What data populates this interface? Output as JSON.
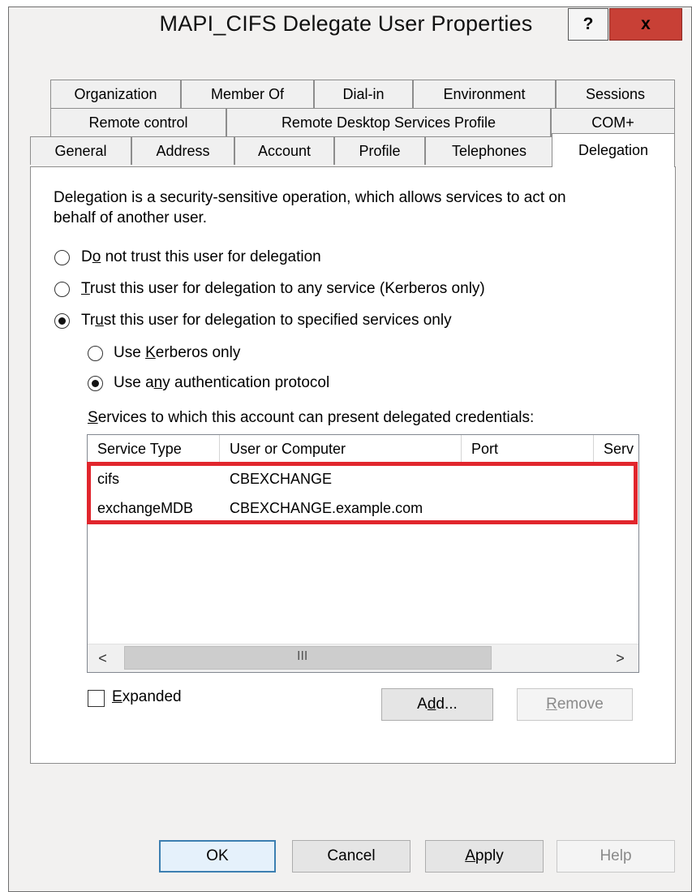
{
  "window": {
    "title": "MAPI_CIFS Delegate User Properties",
    "help_label": "?",
    "close_label": "x"
  },
  "tabs": {
    "row1": [
      "Organization",
      "Member Of",
      "Dial-in",
      "Environment",
      "Sessions"
    ],
    "row2": [
      "Remote control",
      "Remote Desktop Services Profile",
      "COM+"
    ],
    "row3": [
      "General",
      "Address",
      "Account",
      "Profile",
      "Telephones",
      "Delegation"
    ],
    "active": "Delegation"
  },
  "delegation": {
    "intro_line1": "Delegation is a security-sensitive operation, which allows services to act on",
    "intro_line2": "behalf of another user.",
    "options": [
      {
        "pre": "D",
        "key": "o",
        "post": " not trust this user for delegation",
        "checked": false
      },
      {
        "pre": "",
        "key": "T",
        "post": "rust this user for delegation to any service (Kerberos only)",
        "checked": false
      },
      {
        "pre": "Tr",
        "key": "u",
        "post": "st this user for delegation to specified services only",
        "checked": true
      }
    ],
    "sub_options": [
      {
        "pre": "Use ",
        "key": "K",
        "post": "erberos only",
        "checked": false
      },
      {
        "pre": "Use a",
        "key": "n",
        "post": "y authentication protocol",
        "checked": true
      }
    ],
    "services_label_key": "S",
    "services_label_rest": "ervices to which this account can present delegated credentials:"
  },
  "services_table": {
    "columns": [
      "Service Type",
      "User or Computer",
      "Port",
      "Serv"
    ],
    "rows": [
      {
        "service_type": "cifs",
        "user_or_computer": "CBEXCHANGE"
      },
      {
        "service_type": "exchangeMDB",
        "user_or_computer": "CBEXCHANGE.example.com"
      }
    ],
    "scroll_left": "<",
    "scroll_thumb_grip": "III",
    "scroll_right": ">",
    "highlight_color": "#e1262d"
  },
  "controls": {
    "expanded_key": "E",
    "expanded_rest": "xpanded",
    "expanded_checked": false,
    "add_pre": "A",
    "add_key": "d",
    "add_post": "d...",
    "remove_key": "R",
    "remove_rest": "emove"
  },
  "footer": {
    "ok": "OK",
    "cancel": "Cancel",
    "apply_key": "A",
    "apply_rest": "pply",
    "help": "Help"
  }
}
